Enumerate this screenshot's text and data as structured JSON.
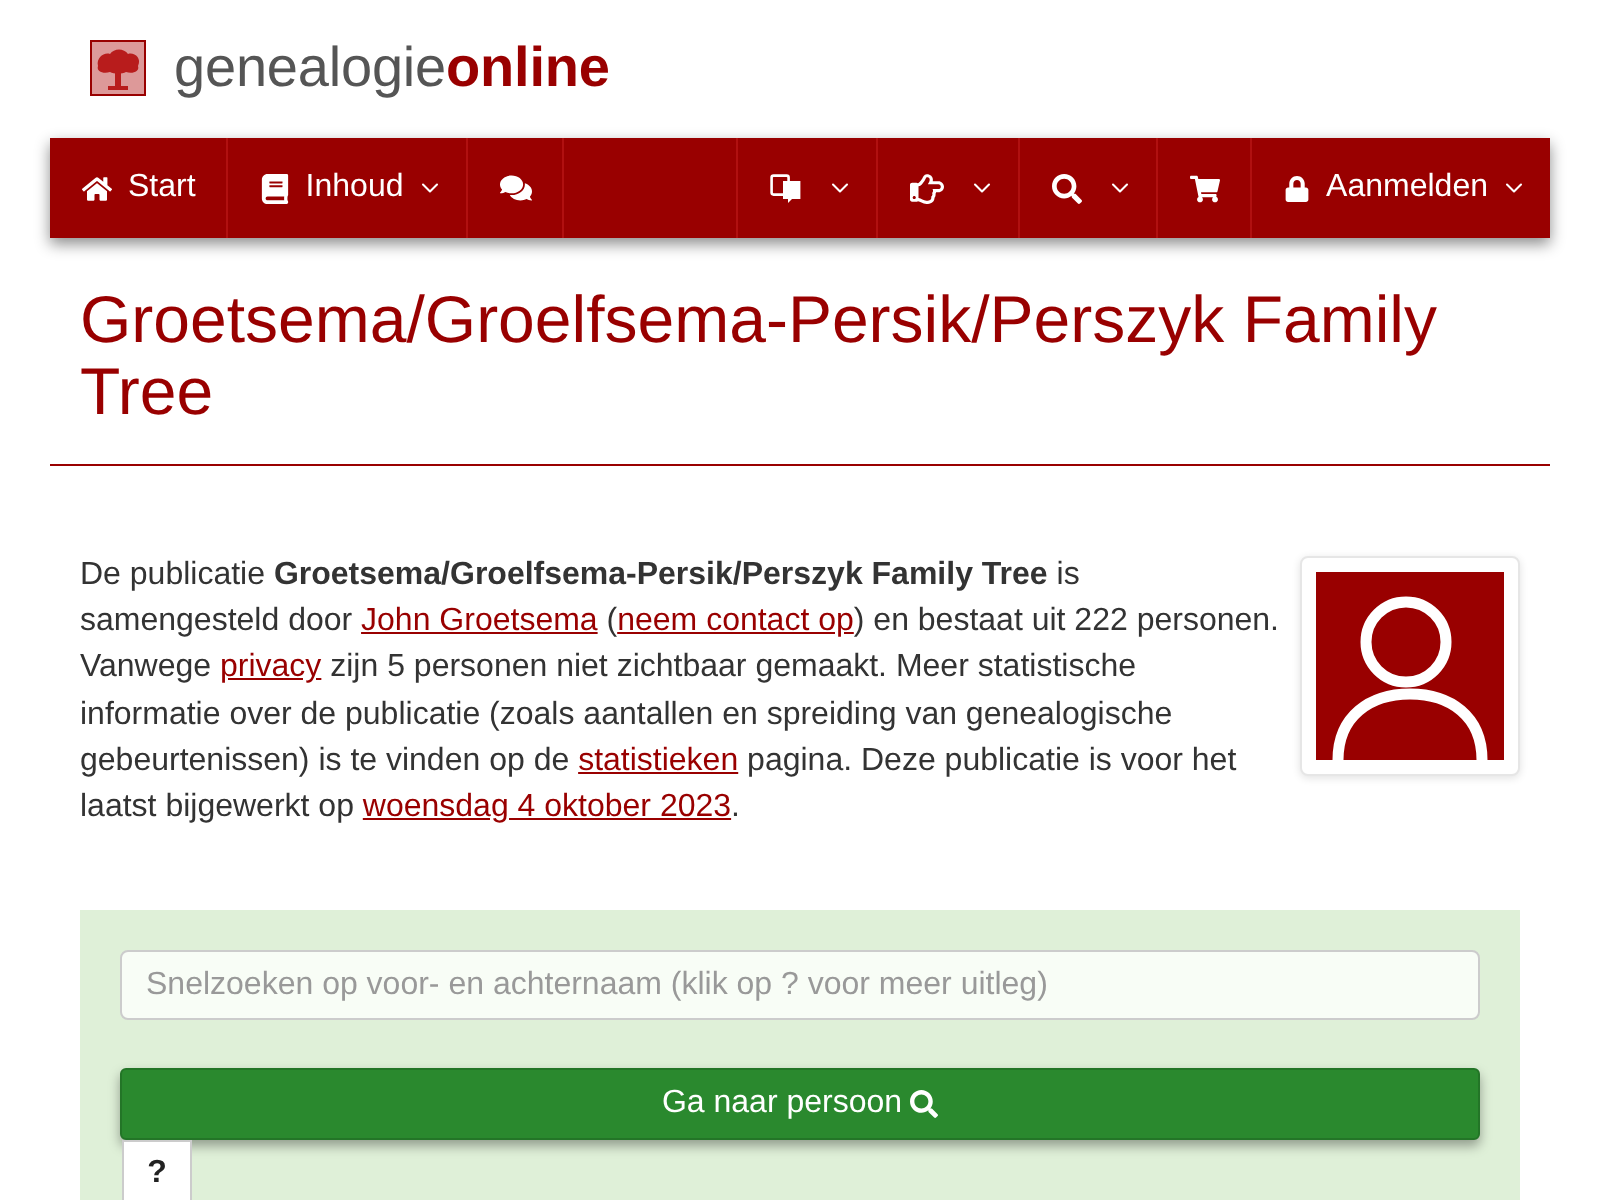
{
  "logo": {
    "text": "genealogie**online**"
  },
  "nav": {
    "left": [
      {
        "label": "Start",
        "dropdown": false
      },
      {
        "label": "Inhoud",
        "dropdown": true
      },
      {
        "dropdown": false
      }
    ],
    "right": [
      {
        "dropdown": true
      },
      {
        "dropdown": true
      },
      {
        "dropdown": true
      },
      {
        "dropdown": false
      },
      {
        "label": "Aanmelden",
        "dropdown": true
      }
    ]
  },
  "title": "Groetsema/Groelfsema-Persik/Perszyk Family Tree",
  "intro": [
    {
      "kind": "text",
      "text": "De publicatie **Groetsema/Groelfsema-Persik/Perszyk Family Tree** is samengesteld door "
    },
    {
      "kind": "link",
      "text": "John Groetsema"
    },
    {
      "kind": "text",
      "text": " ("
    },
    {
      "kind": "link",
      "text": "neem contact op"
    },
    {
      "kind": "text",
      "text": ") en bestaat uit 222 personen. Vanwege "
    },
    {
      "kind": "link",
      "text": "privacy"
    },
    {
      "kind": "text",
      "text": " zijn 5 personen niet zichtbaar gemaakt. Meer statistische informatie over de publicatie (zoals aantallen en spreiding van genealogische gebeurtenissen) is te vinden op de "
    },
    {
      "kind": "link",
      "text": "statistieken"
    },
    {
      "kind": "text",
      "text": " pagina. Deze publicatie is voor het laatst bijgewerkt op "
    },
    {
      "kind": "link",
      "text": "woensdag 4 oktober 2023"
    },
    {
      "kind": "text",
      "text": "."
    }
  ],
  "quick_search": {
    "placeholder": "Snelzoeken op voor- en achternaam (klik op ? voor meer uitleg)",
    "button": "Ga naar persoon",
    "help": "?"
  }
}
